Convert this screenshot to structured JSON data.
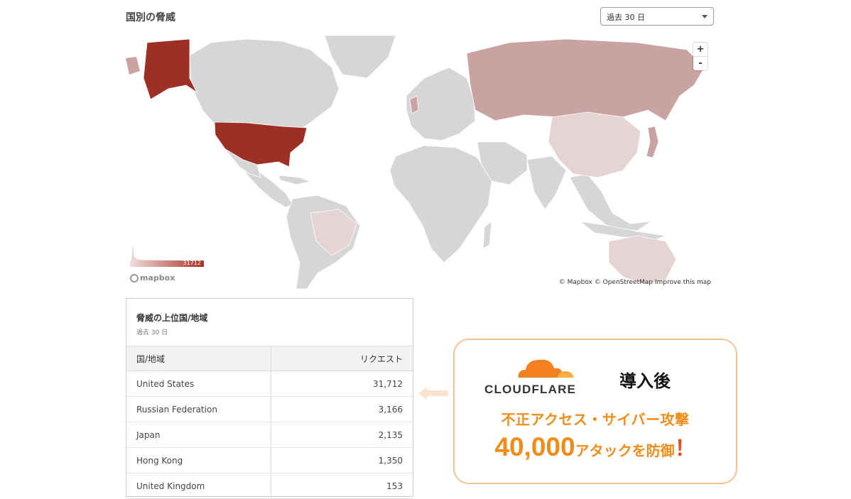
{
  "map_section": {
    "title": "国別の脅威",
    "range_select": {
      "value": "過去 30 日"
    },
    "zoom": {
      "in": "+",
      "out": "-"
    },
    "legend": {
      "min": "0",
      "max": "31712"
    },
    "mapbox_logo": "mapbox",
    "attribution": "© Mapbox © OpenStreetMap Improve this map",
    "colors": {
      "high": "#9e2f25",
      "mid": "#c9a2a2",
      "low": "#e6d3d3",
      "none": "#d6d6d6"
    }
  },
  "top_countries": {
    "title": "脅威の上位国/地域",
    "subtitle": "過去 30 日",
    "columns": [
      "国/地域",
      "リクエスト"
    ],
    "rows": [
      {
        "country": "United States",
        "requests": "31,712"
      },
      {
        "country": "Russian Federation",
        "requests": "3,166"
      },
      {
        "country": "Japan",
        "requests": "2,135"
      },
      {
        "country": "Hong Kong",
        "requests": "1,350"
      },
      {
        "country": "United Kingdom",
        "requests": "153"
      }
    ]
  },
  "promo": {
    "logo_text": "CLOUDFLARE",
    "after_label": "導入後",
    "line1": "不正アクセス・サイバー攻撃",
    "number": "40,000",
    "line2_text": "アタックを防御",
    "exclaim": "！",
    "accent_color": "#f08c1a",
    "logo_cloud_color": "#f38020"
  }
}
